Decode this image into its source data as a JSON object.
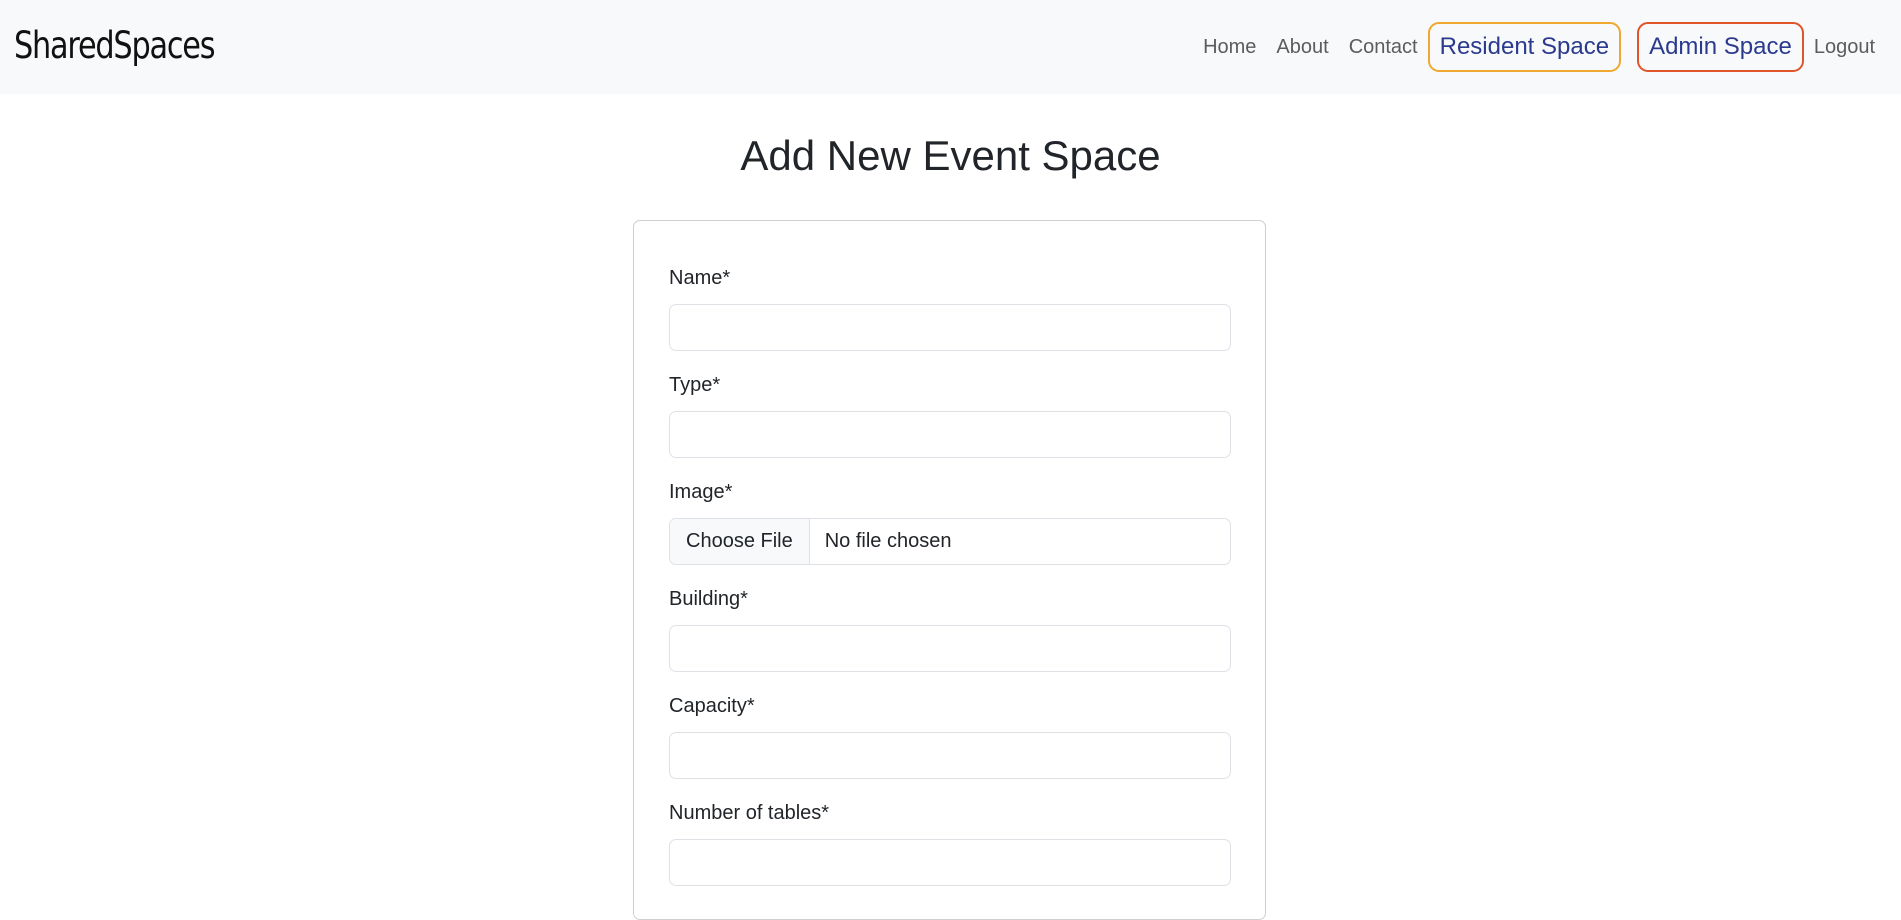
{
  "navbar": {
    "brand": "SharedSpaces",
    "links": {
      "home": "Home",
      "about": "About",
      "contact": "Contact",
      "resident_space": "Resident Space",
      "admin_space": "Admin Space",
      "logout": "Logout"
    },
    "colors": {
      "background": "#f8f9fa",
      "resident_border": "#f0a830",
      "admin_border": "#e0542a",
      "pill_text": "#2b3a8f"
    }
  },
  "page": {
    "title": "Add New Event Space"
  },
  "form": {
    "fields": {
      "name": {
        "label": "Name*",
        "value": ""
      },
      "type": {
        "label": "Type*",
        "value": ""
      },
      "image": {
        "label": "Image*",
        "button": "Choose File",
        "status": "No file chosen"
      },
      "building": {
        "label": "Building*",
        "value": ""
      },
      "capacity": {
        "label": "Capacity*",
        "value": ""
      },
      "tables": {
        "label": "Number of tables*",
        "value": ""
      }
    }
  }
}
